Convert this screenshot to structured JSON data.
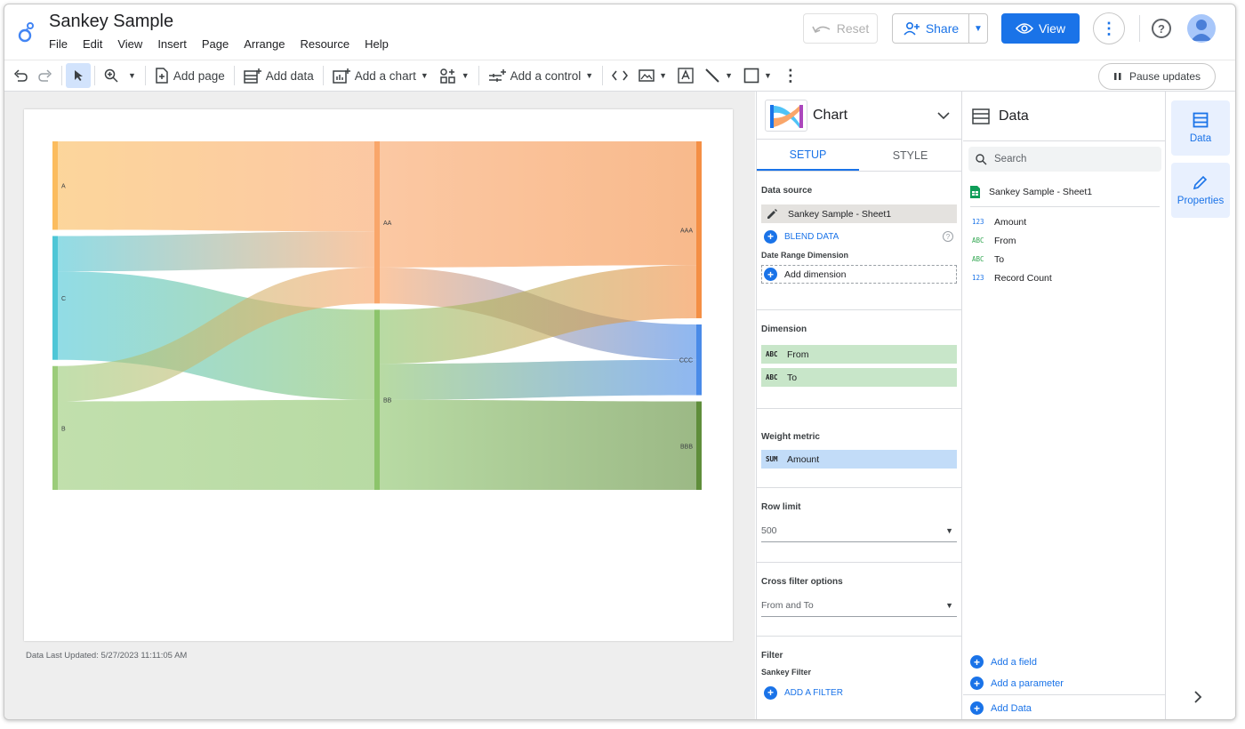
{
  "app": {
    "title": "Sankey Sample",
    "menu": [
      "File",
      "Edit",
      "View",
      "Insert",
      "Page",
      "Arrange",
      "Resource",
      "Help"
    ],
    "reset_label": "Reset",
    "share_label": "Share",
    "view_label": "View"
  },
  "toolbar": {
    "add_page": "Add page",
    "add_data": "Add data",
    "add_chart": "Add a chart",
    "add_control": "Add a control",
    "pause_updates": "Pause updates"
  },
  "canvas": {
    "last_updated": "Data Last Updated: 5/27/2023 11:11:05 AM"
  },
  "chart_data": {
    "type": "sankey",
    "nodes": [
      "A",
      "C",
      "B",
      "AA",
      "BB",
      "AAA",
      "CCC",
      "BBB"
    ],
    "links": [
      {
        "from": "A",
        "to": "AA",
        "value": 5
      },
      {
        "from": "C",
        "to": "AA",
        "value": 2
      },
      {
        "from": "C",
        "to": "BB",
        "value": 5
      },
      {
        "from": "B",
        "to": "AA",
        "value": 2
      },
      {
        "from": "B",
        "to": "BB",
        "value": 5
      },
      {
        "from": "AA",
        "to": "AAA",
        "value": 7
      },
      {
        "from": "AA",
        "to": "CCC",
        "value": 2
      },
      {
        "from": "BB",
        "to": "AAA",
        "value": 3
      },
      {
        "from": "BB",
        "to": "CCC",
        "value": 2
      },
      {
        "from": "BB",
        "to": "BBB",
        "value": 5
      }
    ],
    "colors": {
      "A": "#fbbc5e",
      "C": "#4ec6d6",
      "B": "#9bcc7a",
      "AA": "#f9a66a",
      "BB": "#8cc46b",
      "AAA": "#f48f45",
      "CCC": "#4a8be8",
      "BBB": "#5f8e3b"
    }
  },
  "chart_panel": {
    "title": "Chart",
    "tab_setup": "SETUP",
    "tab_style": "STYLE",
    "data_source_label": "Data source",
    "data_source_value": "Sankey Sample - Sheet1",
    "blend_data": "BLEND DATA",
    "date_range_label": "Date Range Dimension",
    "add_dimension": "Add dimension",
    "dimension_label": "Dimension",
    "dimension_type": "ABC",
    "dimensions": [
      "From",
      "To"
    ],
    "weight_metric_label": "Weight metric",
    "metric_agg": "SUM",
    "metric": "Amount",
    "row_limit_label": "Row limit",
    "row_limit_value": "500",
    "cross_filter_label": "Cross filter options",
    "cross_filter_value": "From and To",
    "filter_label": "Filter",
    "filter_name": "Sankey Filter",
    "add_filter": "ADD A FILTER"
  },
  "data_panel": {
    "title": "Data",
    "search_placeholder": "Search",
    "source": "Sankey Sample - Sheet1",
    "fields": [
      {
        "type": "123",
        "name": "Amount"
      },
      {
        "type": "ABC",
        "name": "From"
      },
      {
        "type": "ABC",
        "name": "To"
      },
      {
        "type": "123",
        "name": "Record Count"
      }
    ],
    "add_field": "Add a field",
    "add_parameter": "Add a parameter",
    "add_data": "Add Data"
  },
  "rail": {
    "data_label": "Data",
    "properties_label": "Properties"
  }
}
